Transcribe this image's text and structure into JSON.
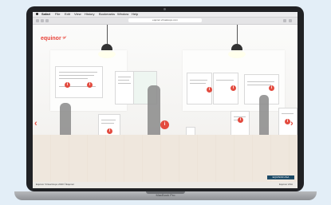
{
  "menubar": {
    "app_name": "Safari",
    "items": [
      "File",
      "Edit",
      "View",
      "History",
      "Bookmarks",
      "Window",
      "Help"
    ]
  },
  "browser": {
    "url": "equinor.virtualexpo.com"
  },
  "brand": {
    "logo_text": "equinor",
    "accent_color": "#e8433a"
  },
  "posters": {
    "info_symbol": "i"
  },
  "footer": {
    "left_text": "Equinor Virtual Expo 2020 ©Equinor",
    "right_text": "Equinor ASA",
    "badge_text": "EQUINOR ASA"
  },
  "device": {
    "label": "MacBook Pro"
  }
}
